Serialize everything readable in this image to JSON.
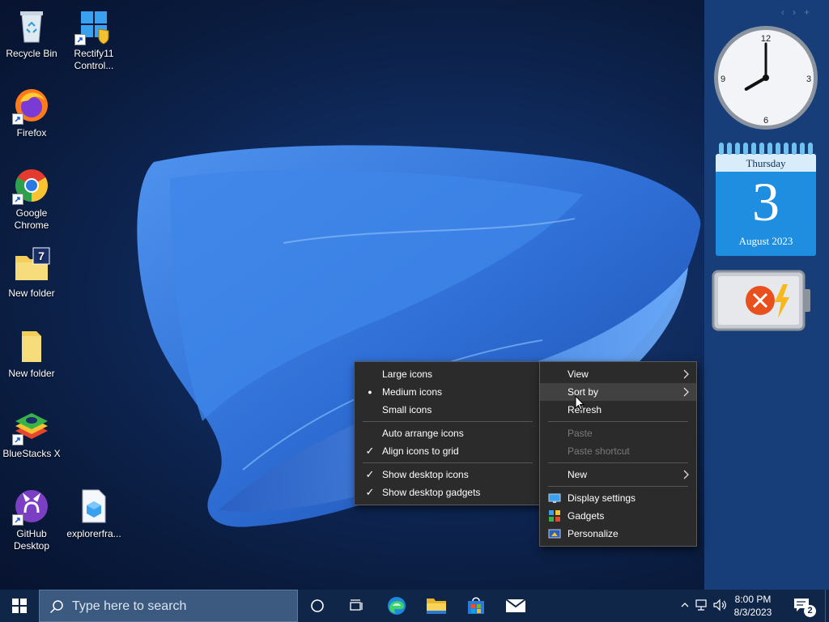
{
  "desktop": {
    "icons": [
      {
        "label": "Recycle Bin",
        "icon": "recycle-bin-icon"
      },
      {
        "label": "Rectify11 Control...",
        "icon": "control-panel-icon"
      },
      {
        "label": "Firefox",
        "icon": "firefox-icon"
      },
      {
        "label": "Google Chrome",
        "icon": "chrome-icon"
      },
      {
        "label": "New folder",
        "icon": "folder-icon",
        "badge": "7"
      },
      {
        "label": "New folder",
        "icon": "folder-icon"
      },
      {
        "label": "BlueStacks X",
        "icon": "bluestacks-icon"
      },
      {
        "label": "GitHub Desktop",
        "icon": "github-icon"
      },
      {
        "label": "explorerfra...",
        "icon": "file-icon"
      }
    ]
  },
  "gadgets": {
    "clock": {
      "numbers": [
        "12",
        "3",
        "6",
        "9"
      ],
      "hour": 8,
      "minute": 0
    },
    "calendar": {
      "day": "Thursday",
      "date": "3",
      "month_year": "August 2023"
    },
    "battery": {
      "status": "not-charging",
      "icon": "battery-error-icon"
    }
  },
  "view_menu": {
    "items": [
      {
        "label": "Large icons",
        "mark": ""
      },
      {
        "label": "Medium icons",
        "mark": "●"
      },
      {
        "label": "Small icons",
        "mark": ""
      },
      {
        "label": "Auto arrange icons",
        "mark": ""
      },
      {
        "label": "Align icons to grid",
        "mark": "✓"
      },
      {
        "label": "Show desktop icons",
        "mark": "✓"
      },
      {
        "label": "Show desktop gadgets",
        "mark": "✓"
      }
    ]
  },
  "context_menu": {
    "items": [
      {
        "label": "View"
      },
      {
        "label": "Sort by"
      },
      {
        "label": "Refresh"
      },
      {
        "label": "Paste"
      },
      {
        "label": "Paste shortcut"
      },
      {
        "label": "New"
      },
      {
        "label": "Display settings"
      },
      {
        "label": "Gadgets"
      },
      {
        "label": "Personalize"
      }
    ]
  },
  "taskbar": {
    "search_placeholder": "Type here to search",
    "time": "8:00 PM",
    "date": "8/3/2023",
    "notification_count": "2",
    "accent": "#0f2648"
  }
}
